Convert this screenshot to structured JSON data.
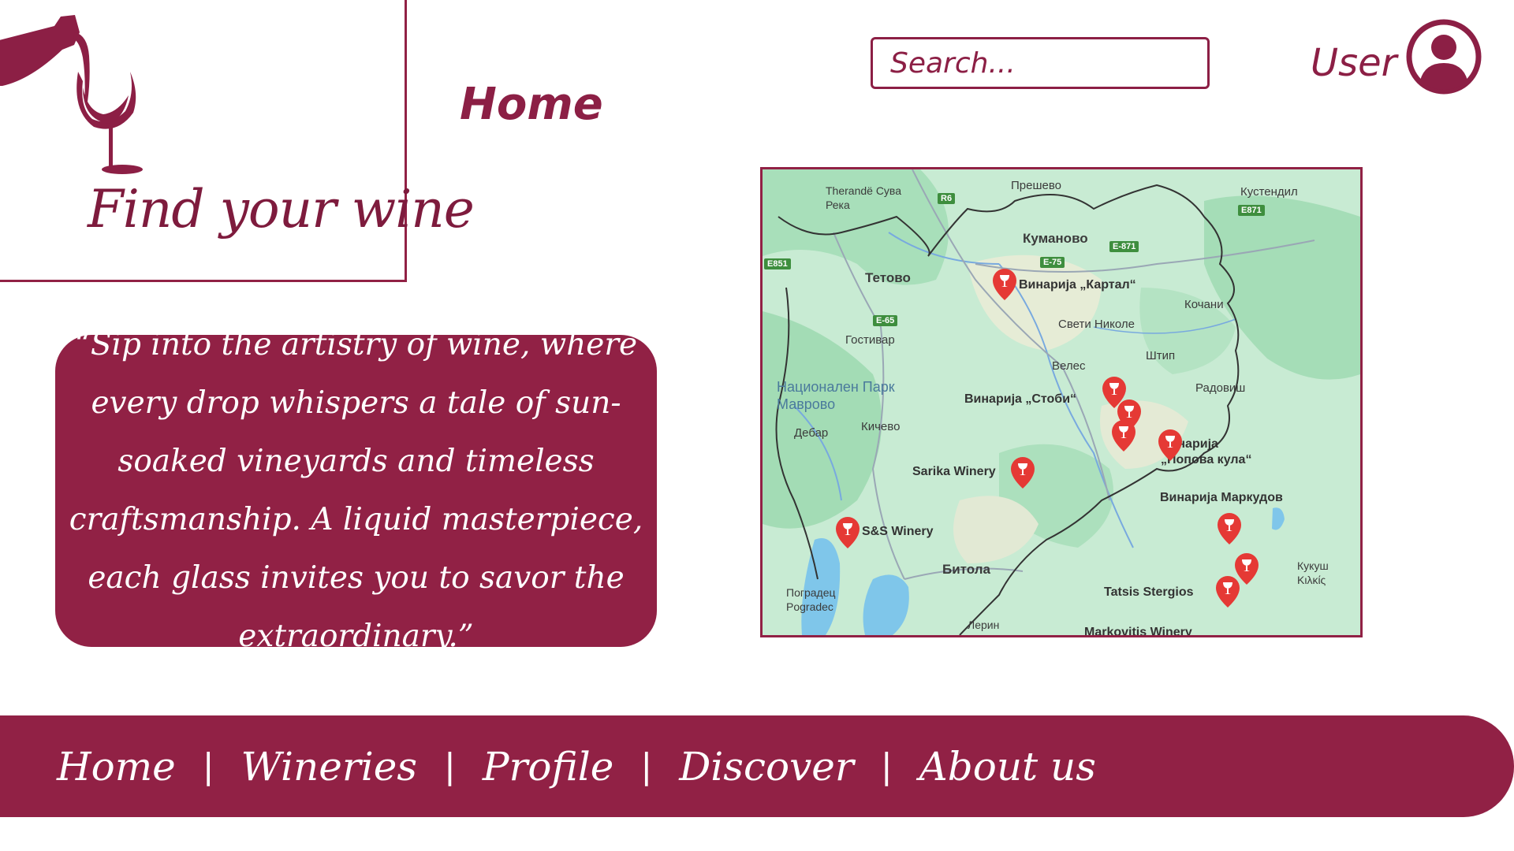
{
  "app": {
    "logo_text": "Find your wine",
    "logo_icon": "wine-bottle-pouring-into-glass-icon"
  },
  "header": {
    "page_title": "Home",
    "search_placeholder": "Search...",
    "user_label": "User",
    "user_icon": "user-circle-icon"
  },
  "quote": {
    "text": "“Sip into the artistry of wine, where every drop whispers a tale of sun-soaked vineyards and timeless craftsmanship. A liquid masterpiece, each glass invites you to savor the extraordinary.”"
  },
  "map": {
    "places": [
      {
        "label": "Куманово"
      },
      {
        "label": "Тетово"
      },
      {
        "label": "Гостивар"
      },
      {
        "label": "Свети Николе"
      },
      {
        "label": "Кочани"
      },
      {
        "label": "Велес"
      },
      {
        "label": "Штип"
      },
      {
        "label": "Радовиш"
      },
      {
        "label": "Национален Парк Маврово"
      },
      {
        "label": "Кичево"
      },
      {
        "label": "Дебар"
      },
      {
        "label": "Битола"
      },
      {
        "label": "Поградец Pogradec"
      },
      {
        "label": "Прешево"
      },
      {
        "label": "Кустендил"
      },
      {
        "label": "Therandë Сува Река"
      },
      {
        "label": "Кукуш Κιλκίς"
      },
      {
        "label": "Лерин"
      }
    ],
    "wineries": [
      {
        "label": "Винарија „Картал“"
      },
      {
        "label": "Винарија „Стоби“"
      },
      {
        "label": "Sarika Winery"
      },
      {
        "label": "S&S Winery"
      },
      {
        "label": "Винарија „Попова кула“"
      },
      {
        "label": "Винарија Маркудов"
      },
      {
        "label": "Tatsis Stergios"
      },
      {
        "label": "Markovitis Winery"
      }
    ],
    "road_labels": [
      "R6",
      "E871",
      "E-871",
      "E-75",
      "E-65",
      "E851"
    ],
    "pin_color": "#e53935",
    "border_color": "#912145"
  },
  "nav": {
    "items": [
      "Home",
      "Wineries",
      "Profile",
      "Discover",
      "About us"
    ],
    "separator": "|"
  },
  "colors": {
    "brand": "#912145",
    "text_on_brand": "#ffffff",
    "background": "#ffffff"
  }
}
